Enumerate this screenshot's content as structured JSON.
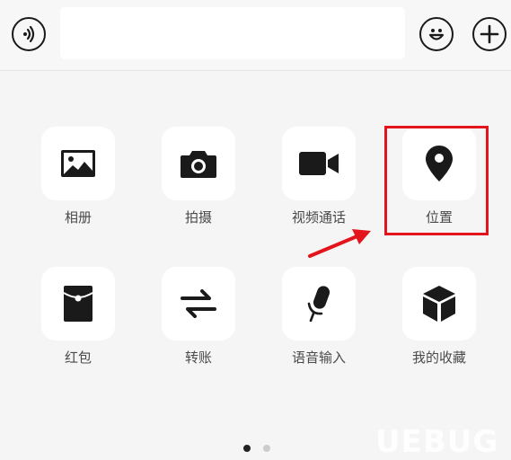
{
  "input_bar": {
    "message_value": ""
  },
  "panel": {
    "row1": [
      {
        "label": "相册",
        "icon": "photo-icon"
      },
      {
        "label": "拍摄",
        "icon": "camera-icon"
      },
      {
        "label": "视频通话",
        "icon": "video-call-icon"
      },
      {
        "label": "位置",
        "icon": "location-pin-icon"
      }
    ],
    "row2": [
      {
        "label": "红包",
        "icon": "red-packet-icon"
      },
      {
        "label": "转账",
        "icon": "transfer-icon"
      },
      {
        "label": "语音输入",
        "icon": "microphone-icon"
      },
      {
        "label": "我的收藏",
        "icon": "favorites-box-icon"
      }
    ],
    "page_count": 2,
    "current_page": 1
  },
  "annotation": {
    "highlight_color": "#e3141c",
    "highlight_target": "位置"
  },
  "watermark": {
    "text": "UEBUG"
  },
  "colors": {
    "icon": "#1a1a1a",
    "label": "#4a4a4a",
    "dot_active": "#222222",
    "dot_inactive": "#cccccc"
  }
}
